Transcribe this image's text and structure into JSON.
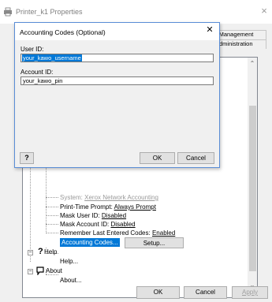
{
  "main_window": {
    "title": "Printer_k1 Properties",
    "close_glyph": "×",
    "tabs": [
      "r Management",
      "Administration"
    ],
    "tree": {
      "rows": [
        {
          "prefix": "System: ",
          "value": "Xerox Network Accounting",
          "dim": true
        },
        {
          "prefix": "Print-Time Prompt: ",
          "value": "Always Prompt"
        },
        {
          "prefix": "Mask User ID: ",
          "value": "Disabled"
        },
        {
          "prefix": "Mask Account ID: ",
          "value": "Disabled"
        },
        {
          "prefix": "Remember Last Entered Codes: ",
          "value": "Enabled"
        }
      ],
      "selected_item": "Accounting Codes...",
      "setup_label": "Setup...",
      "help_group": "Help",
      "help_item": "Help...",
      "about_group": "About",
      "about_item": "About..."
    },
    "buttons": {
      "ok": "OK",
      "cancel": "Cancel",
      "apply": "Apply"
    }
  },
  "dialog": {
    "title": "Accounting Codes (Optional)",
    "close_glyph": "✕",
    "user_id_label": "User ID:",
    "user_id_value": "your_kawo_username",
    "account_id_label": "Account ID:",
    "account_id_value": "your_kawo_pin",
    "help_label": "?",
    "ok_label": "OK",
    "cancel_label": "Cancel"
  },
  "icons": [
    "printer-icon",
    "help-question-icon",
    "about-balloon-icon"
  ],
  "colors": {
    "selection": "#0078d7",
    "dialog_border": "#5a8dd6"
  }
}
